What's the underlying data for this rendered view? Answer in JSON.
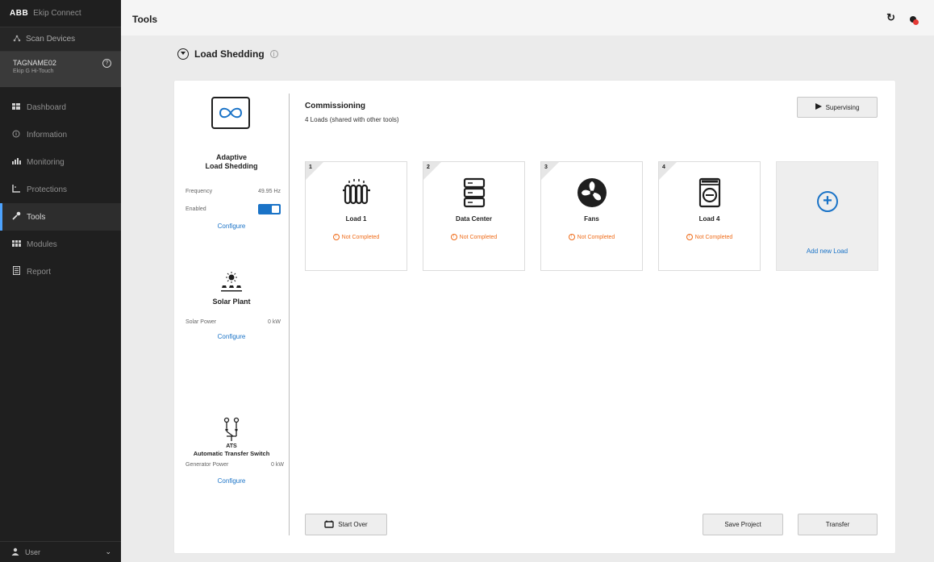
{
  "sidebar": {
    "brand_logo": "ABB",
    "brand_app": "Ekip Connect",
    "scan_label": "Scan Devices",
    "device": {
      "name": "TAGNAME02",
      "type": "Ekip G Hi-Touch"
    },
    "items": [
      {
        "label": "Dashboard",
        "icon": "grid-icon"
      },
      {
        "label": "Information",
        "icon": "info-icon"
      },
      {
        "label": "Monitoring",
        "icon": "bar-chart-icon"
      },
      {
        "label": "Protections",
        "icon": "protection-icon"
      },
      {
        "label": "Tools",
        "icon": "wrench-icon",
        "active": true
      },
      {
        "label": "Modules",
        "icon": "modules-icon"
      },
      {
        "label": "Report",
        "icon": "report-icon"
      }
    ],
    "user_label": "User"
  },
  "topbar": {
    "title": "Tools"
  },
  "section": {
    "title": "Load Shedding"
  },
  "tools": {
    "als": {
      "name_line1": "Adaptive",
      "name_line2": "Load Shedding",
      "freq_label": "Frequency",
      "freq_value": "49.95 Hz",
      "enabled_label": "Enabled",
      "enabled": true,
      "configure": "Configure"
    },
    "solar": {
      "name": "Solar Plant",
      "power_label": "Solar Power",
      "power_value": "0 kW",
      "configure": "Configure"
    },
    "ats": {
      "abbr": "ATS",
      "name": "Automatic Transfer Switch",
      "power_label": "Generator Power",
      "power_value": "0 kW",
      "configure": "Configure"
    }
  },
  "commissioning": {
    "title": "Commissioning",
    "subtitle": "4 Loads (shared with other tools)",
    "supervising_label": "Supervising"
  },
  "loads": [
    {
      "num": "1",
      "name": "Load 1",
      "icon": "radiator-icon",
      "status": "Not Completed"
    },
    {
      "num": "2",
      "name": "Data Center",
      "icon": "server-icon",
      "status": "Not Completed"
    },
    {
      "num": "3",
      "name": "Fans",
      "icon": "fan-icon",
      "status": "Not Completed"
    },
    {
      "num": "4",
      "name": "Load 4",
      "icon": "washing-machine-icon",
      "status": "Not Completed"
    }
  ],
  "add_load_label": "Add new Load",
  "actions": {
    "start_over": "Start Over",
    "save_project": "Save Project",
    "transfer": "Transfer"
  },
  "colors": {
    "sidebar_bg": "#1f1f1f",
    "accent_blue": "#1a73c7",
    "warning_orange": "#ef6c1a",
    "alert_red": "#e53935"
  }
}
